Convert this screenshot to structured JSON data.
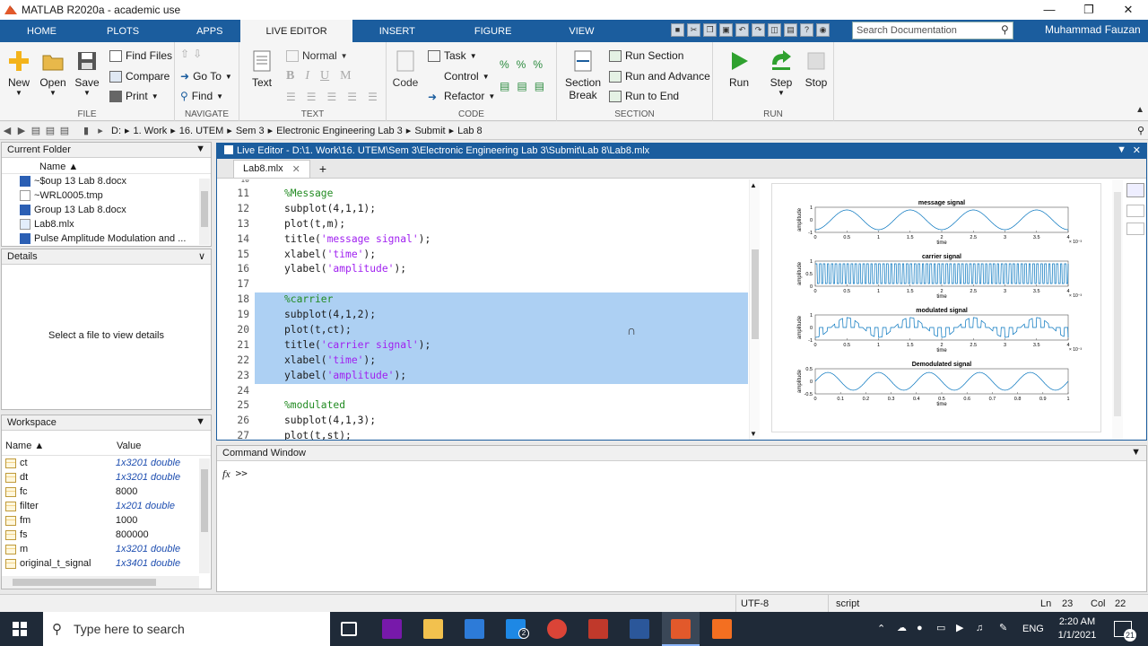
{
  "window": {
    "title": "MATLAB R2020a - academic use"
  },
  "tabs": [
    "HOME",
    "PLOTS",
    "APPS",
    "LIVE EDITOR",
    "INSERT",
    "FIGURE",
    "VIEW"
  ],
  "search": {
    "placeholder": "Search Documentation"
  },
  "user": "Muhammad Fauzan",
  "ribbon": {
    "file": {
      "label": "FILE",
      "new": "New",
      "open": "Open",
      "save": "Save",
      "find_files": "Find Files",
      "compare": "Compare",
      "print": "Print"
    },
    "navigate": {
      "label": "NAVIGATE",
      "goto": "Go To",
      "find": "Find"
    },
    "text": {
      "label": "TEXT",
      "text_btn": "Text",
      "style": "Normal",
      "bold": "B",
      "italic": "I",
      "underline": "U",
      "mono": "M"
    },
    "code": {
      "label": "CODE",
      "code_btn": "Code",
      "task": "Task",
      "control": "Control",
      "refactor": "Refactor"
    },
    "section": {
      "label": "SECTION",
      "section_break": "Section Break",
      "run_section": "Run Section",
      "run_advance": "Run and Advance",
      "run_end": "Run to End"
    },
    "run": {
      "label": "RUN",
      "run": "Run",
      "step": "Step",
      "stop": "Stop"
    }
  },
  "path": [
    "D:",
    "1. Work",
    "16. UTEM",
    "Sem 3",
    "Electronic Engineering Lab 3",
    "Submit",
    "Lab 8"
  ],
  "current_folder": {
    "title": "Current Folder",
    "col_name": "Name ▲",
    "files": [
      "~$oup 13 Lab 8.docx",
      "~WRL0005.tmp",
      "Group 13 Lab 8.docx",
      "Lab8.mlx",
      "Pulse Amplitude Modulation and ..."
    ]
  },
  "details": {
    "title": "Details",
    "message": "Select a file to view details"
  },
  "workspace": {
    "title": "Workspace",
    "col_name": "Name ▲",
    "col_value": "Value",
    "vars": [
      {
        "name": "ct",
        "value": "1x3201 double",
        "italic": true
      },
      {
        "name": "dt",
        "value": "1x3201 double",
        "italic": true
      },
      {
        "name": "fc",
        "value": "8000",
        "italic": false
      },
      {
        "name": "filter",
        "value": "1x201 double",
        "italic": true
      },
      {
        "name": "fm",
        "value": "1000",
        "italic": false
      },
      {
        "name": "fs",
        "value": "800000",
        "italic": false
      },
      {
        "name": "m",
        "value": "1x3201 double",
        "italic": true
      },
      {
        "name": "original_t_signal",
        "value": "1x3401 double",
        "italic": true
      }
    ]
  },
  "editor": {
    "title": "Live Editor - D:\\1. Work\\16. UTEM\\Sem 3\\Electronic Engineering Lab 3\\Submit\\Lab 8\\Lab8.mlx",
    "tab": "Lab8.mlx",
    "lines": [
      {
        "n": "10",
        "t": ""
      },
      {
        "n": "11",
        "t": "%Message"
      },
      {
        "n": "12",
        "t": "subplot(4,1,1);"
      },
      {
        "n": "13",
        "t": "plot(t,m);"
      },
      {
        "n": "14",
        "t": "title('message signal');"
      },
      {
        "n": "15",
        "t": "xlabel('time');"
      },
      {
        "n": "16",
        "t": "ylabel('amplitude');"
      },
      {
        "n": "17",
        "t": ""
      },
      {
        "n": "18",
        "t": "%carrier"
      },
      {
        "n": "19",
        "t": "subplot(4,1,2);"
      },
      {
        "n": "20",
        "t": "plot(t,ct);"
      },
      {
        "n": "21",
        "t": "title('carrier signal');"
      },
      {
        "n": "22",
        "t": "xlabel('time');"
      },
      {
        "n": "23",
        "t": "ylabel('amplitude');"
      },
      {
        "n": "24",
        "t": ""
      },
      {
        "n": "25",
        "t": "%modulated"
      },
      {
        "n": "26",
        "t": "subplot(4,1,3);"
      },
      {
        "n": "27",
        "t": "plot(t,st);"
      }
    ],
    "selected_from": 18,
    "selected_to": 23
  },
  "figure": {
    "ylabel": "amplitude",
    "xlabel": "time",
    "exp_label": "× 10⁻³",
    "subplots": [
      {
        "title": "message signal",
        "xticks": [
          "0",
          "0.5",
          "1",
          "1.5",
          "2",
          "2.5",
          "3",
          "3.5",
          "4"
        ],
        "yticks": [
          "1",
          "0",
          "-1"
        ],
        "kind": "sine",
        "exp": true
      },
      {
        "title": "carrier signal",
        "xticks": [
          "0",
          "0.5",
          "1",
          "1.5",
          "2",
          "2.5",
          "3",
          "3.5",
          "4"
        ],
        "yticks": [
          "1",
          "0.5",
          "0"
        ],
        "kind": "carrier",
        "exp": true
      },
      {
        "title": "modulated signal",
        "xticks": [
          "0",
          "0.5",
          "1",
          "1.5",
          "2",
          "2.5",
          "3",
          "3.5",
          "4"
        ],
        "yticks": [
          "1",
          "0",
          "-1"
        ],
        "kind": "pam",
        "exp": true
      },
      {
        "title": "Demodulated signal",
        "xticks": [
          "0",
          "0.1",
          "0.2",
          "0.3",
          "0.4",
          "0.5",
          "0.6",
          "0.7",
          "0.8",
          "0.9",
          "1"
        ],
        "yticks": [
          "0.5",
          "0",
          "-0.5"
        ],
        "kind": "demod",
        "exp": false
      }
    ]
  },
  "command_window": {
    "title": "Command Window",
    "fx": "fx",
    "prompt": ">>"
  },
  "status": {
    "encoding": "UTF-8",
    "mode": "script",
    "ln_label": "Ln",
    "ln": "23",
    "col_label": "Col",
    "col": "22"
  },
  "taskbar": {
    "search": "Type here to search",
    "lang": "ENG",
    "time": "2:20 AM",
    "date": "1/1/2021",
    "notif": "21",
    "mail_badge": "2"
  }
}
